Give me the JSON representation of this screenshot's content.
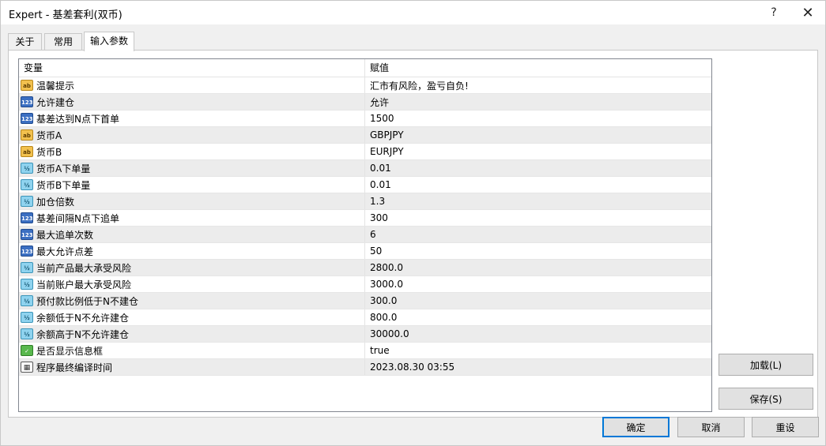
{
  "window": {
    "title": "Expert - 基差套利(双币)",
    "help_glyph": "?",
    "close_glyph": "✕"
  },
  "tabs": [
    {
      "label": "关于"
    },
    {
      "label": "常用"
    },
    {
      "label": "输入参数"
    }
  ],
  "grid": {
    "headers": {
      "variable": "变量",
      "value": "赋值"
    },
    "rows": [
      {
        "type": "string",
        "icon": "ab",
        "name": "温馨提示",
        "value": "汇市有风险，盈亏自负!"
      },
      {
        "type": "int",
        "icon": "123",
        "name": "允许建仓",
        "value": "允许"
      },
      {
        "type": "int",
        "icon": "123",
        "name": "基差达到N点下首单",
        "value": "1500"
      },
      {
        "type": "string",
        "icon": "ab",
        "name": "货币A",
        "value": "GBPJPY"
      },
      {
        "type": "string",
        "icon": "ab",
        "name": "货币B",
        "value": "EURJPY"
      },
      {
        "type": "double",
        "icon": "½",
        "name": "货币A下单量",
        "value": "0.01"
      },
      {
        "type": "double",
        "icon": "½",
        "name": "货币B下单量",
        "value": "0.01"
      },
      {
        "type": "double",
        "icon": "½",
        "name": "加仓倍数",
        "value": "1.3"
      },
      {
        "type": "int",
        "icon": "123",
        "name": "基差间隔N点下追单",
        "value": "300"
      },
      {
        "type": "int",
        "icon": "123",
        "name": "最大追单次数",
        "value": "6"
      },
      {
        "type": "int",
        "icon": "123",
        "name": "最大允许点差",
        "value": "50"
      },
      {
        "type": "double",
        "icon": "½",
        "name": "当前产品最大承受风险",
        "value": "2800.0"
      },
      {
        "type": "double",
        "icon": "½",
        "name": "当前账户最大承受风险",
        "value": "3000.0"
      },
      {
        "type": "double",
        "icon": "½",
        "name": "预付款比例低于N不建仓",
        "value": "300.0"
      },
      {
        "type": "double",
        "icon": "½",
        "name": "余额低于N不允许建仓",
        "value": "800.0"
      },
      {
        "type": "double",
        "icon": "½",
        "name": "余额高于N不允许建仓",
        "value": "30000.0"
      },
      {
        "type": "bool",
        "icon": "✓",
        "name": "是否显示信息框",
        "value": "true"
      },
      {
        "type": "datetime",
        "icon": "▦",
        "name": "程序最终编译时间",
        "value": "2023.08.30 03:55"
      }
    ]
  },
  "buttons": {
    "load": "加载(L)",
    "save": "保存(S)",
    "ok": "确定",
    "cancel": "取消",
    "reset": "重设"
  }
}
